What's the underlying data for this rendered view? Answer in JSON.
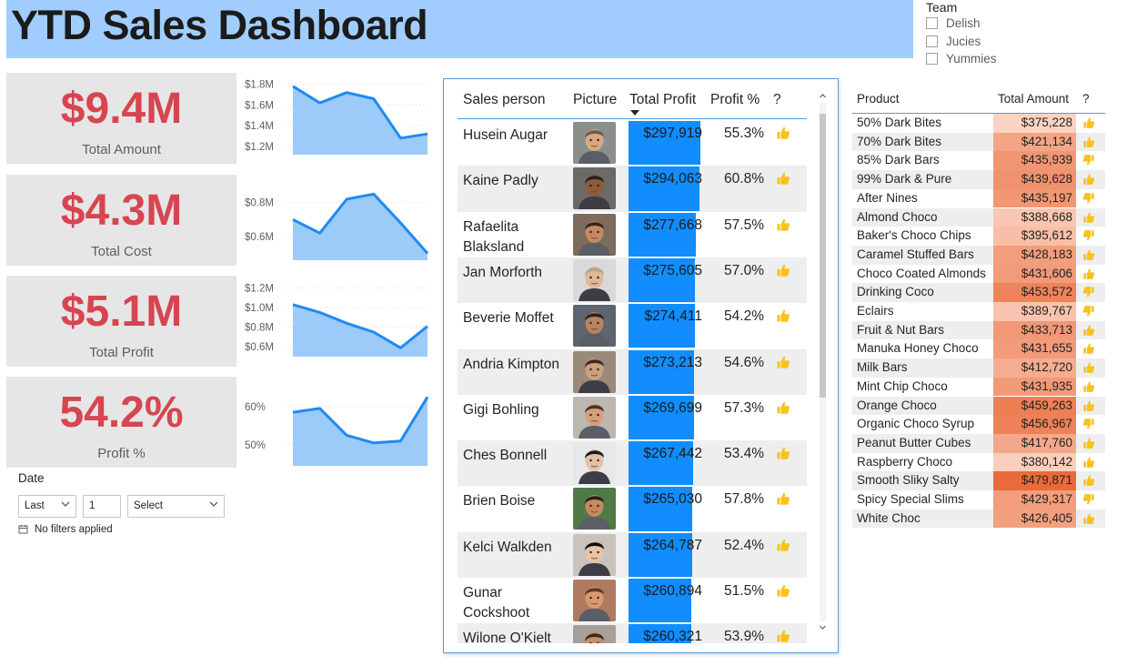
{
  "title": "YTD Sales Dashboard",
  "team_slicer": {
    "title": "Team",
    "items": [
      "Delish",
      "Jucies",
      "Yummies"
    ]
  },
  "kpis": [
    {
      "value": "$9.4M",
      "label": "Total Amount",
      "spark": {
        "ticks": [
          "$1.8M",
          "$1.6M",
          "$1.4M",
          "$1.2M"
        ],
        "tick_values": [
          1.8,
          1.6,
          1.4,
          1.2
        ],
        "range": [
          1.12,
          1.84
        ],
        "values": [
          1.78,
          1.62,
          1.72,
          1.66,
          1.28,
          1.32
        ]
      }
    },
    {
      "value": "$4.3M",
      "label": "Total Cost",
      "spark": {
        "ticks": [
          "$0.8M",
          "$0.6M"
        ],
        "tick_values": [
          0.8,
          0.6
        ],
        "range": [
          0.46,
          0.9
        ],
        "values": [
          0.7,
          0.62,
          0.82,
          0.85,
          0.68,
          0.5
        ]
      }
    },
    {
      "value": "$5.1M",
      "label": "Total Profit",
      "spark": {
        "ticks": [
          "$1.2M",
          "$1.0M",
          "$0.8M",
          "$0.6M"
        ],
        "tick_values": [
          1.2,
          1.0,
          0.8,
          0.6
        ],
        "range": [
          0.5,
          1.26
        ],
        "values": [
          1.03,
          0.95,
          0.84,
          0.75,
          0.59,
          0.81
        ]
      }
    },
    {
      "value": "54.2%",
      "label": "Profit %",
      "spark": {
        "ticks": [
          "60%",
          "50%"
        ],
        "tick_values": [
          60,
          50
        ],
        "range": [
          44.5,
          64
        ],
        "values": [
          58.5,
          59.5,
          52.5,
          50.5,
          51,
          62.5
        ]
      }
    }
  ],
  "date_slicer": {
    "title": "Date",
    "mode": "Last",
    "count": "1",
    "unit": "Select",
    "filter_status": "No filters applied"
  },
  "sales_table": {
    "columns": [
      "Sales person",
      "Picture",
      "Total Profit",
      "Profit %",
      "?"
    ],
    "sort_column": "Total Profit",
    "max_profit": 297919,
    "rows": [
      {
        "name": "Husein Augar",
        "profit_label": "$297,919",
        "profit": 297919,
        "pct": "55.3%",
        "thumb": "up"
      },
      {
        "name": "Kaine Padly",
        "profit_label": "$294,063",
        "profit": 294063,
        "pct": "60.8%",
        "thumb": "up"
      },
      {
        "name": "Rafaelita Blaksland",
        "profit_label": "$277,668",
        "profit": 277668,
        "pct": "57.5%",
        "thumb": "up"
      },
      {
        "name": "Jan Morforth",
        "profit_label": "$275,605",
        "profit": 275605,
        "pct": "57.0%",
        "thumb": "up"
      },
      {
        "name": "Beverie Moffet",
        "profit_label": "$274,411",
        "profit": 274411,
        "pct": "54.2%",
        "thumb": "up"
      },
      {
        "name": "Andria Kimpton",
        "profit_label": "$273,213",
        "profit": 273213,
        "pct": "54.6%",
        "thumb": "up"
      },
      {
        "name": "Gigi Bohling",
        "profit_label": "$269,699",
        "profit": 269699,
        "pct": "57.3%",
        "thumb": "up"
      },
      {
        "name": "Ches Bonnell",
        "profit_label": "$267,442",
        "profit": 267442,
        "pct": "53.4%",
        "thumb": "up"
      },
      {
        "name": "Brien Boise",
        "profit_label": "$265,030",
        "profit": 265030,
        "pct": "57.8%",
        "thumb": "up"
      },
      {
        "name": "Kelci Walkden",
        "profit_label": "$264,787",
        "profit": 264787,
        "pct": "52.4%",
        "thumb": "up"
      },
      {
        "name": "Gunar Cockshoot",
        "profit_label": "$260,894",
        "profit": 260894,
        "pct": "51.5%",
        "thumb": "up"
      },
      {
        "name": "Wilone O'Kielt",
        "profit_label": "$260,321",
        "profit": 260321,
        "pct": "53.9%",
        "thumb": "up"
      }
    ]
  },
  "product_table": {
    "columns": [
      "Product",
      "Total Amount",
      "?"
    ],
    "rows": [
      {
        "name": "50% Dark Bites",
        "amount_label": "$375,228",
        "amount": 375228,
        "thumb": "up"
      },
      {
        "name": "70% Dark Bites",
        "amount_label": "$421,134",
        "amount": 421134,
        "thumb": "up"
      },
      {
        "name": "85% Dark Bars",
        "amount_label": "$435,939",
        "amount": 435939,
        "thumb": "down"
      },
      {
        "name": "99% Dark & Pure",
        "amount_label": "$439,628",
        "amount": 439628,
        "thumb": "up"
      },
      {
        "name": "After Nines",
        "amount_label": "$435,197",
        "amount": 435197,
        "thumb": "down"
      },
      {
        "name": "Almond Choco",
        "amount_label": "$388,668",
        "amount": 388668,
        "thumb": "up"
      },
      {
        "name": "Baker's Choco Chips",
        "amount_label": "$395,612",
        "amount": 395612,
        "thumb": "down"
      },
      {
        "name": "Caramel Stuffed Bars",
        "amount_label": "$428,183",
        "amount": 428183,
        "thumb": "up"
      },
      {
        "name": "Choco Coated Almonds",
        "amount_label": "$431,606",
        "amount": 431606,
        "thumb": "up"
      },
      {
        "name": "Drinking Coco",
        "amount_label": "$453,572",
        "amount": 453572,
        "thumb": "down"
      },
      {
        "name": "Eclairs",
        "amount_label": "$389,767",
        "amount": 389767,
        "thumb": "down"
      },
      {
        "name": "Fruit & Nut Bars",
        "amount_label": "$433,713",
        "amount": 433713,
        "thumb": "up"
      },
      {
        "name": "Manuka Honey Choco",
        "amount_label": "$431,655",
        "amount": 431655,
        "thumb": "up"
      },
      {
        "name": "Milk Bars",
        "amount_label": "$412,720",
        "amount": 412720,
        "thumb": "up"
      },
      {
        "name": "Mint Chip Choco",
        "amount_label": "$431,935",
        "amount": 431935,
        "thumb": "up"
      },
      {
        "name": "Orange Choco",
        "amount_label": "$459,263",
        "amount": 459263,
        "thumb": "up"
      },
      {
        "name": "Organic Choco Syrup",
        "amount_label": "$456,967",
        "amount": 456967,
        "thumb": "down"
      },
      {
        "name": "Peanut Butter Cubes",
        "amount_label": "$417,760",
        "amount": 417760,
        "thumb": "up"
      },
      {
        "name": "Raspberry Choco",
        "amount_label": "$380,142",
        "amount": 380142,
        "thumb": "up"
      },
      {
        "name": "Smooth Sliky Salty",
        "amount_label": "$479,871",
        "amount": 479871,
        "thumb": "up"
      },
      {
        "name": "Spicy Special Slims",
        "amount_label": "$429,317",
        "amount": 429317,
        "thumb": "down"
      },
      {
        "name": "White Choc",
        "amount_label": "$426,405",
        "amount": 426405,
        "thumb": "up"
      }
    ]
  },
  "colors": {
    "kpi_value": "#d64550",
    "banner": "#a0cdfe",
    "bar": "#118dff",
    "spark_line": "#1f8af2",
    "spark_fill": "#9ccbf9",
    "heat_low": "#fbd3c2",
    "heat_high": "#ea6a3a",
    "thumb": "#f7c21b"
  }
}
